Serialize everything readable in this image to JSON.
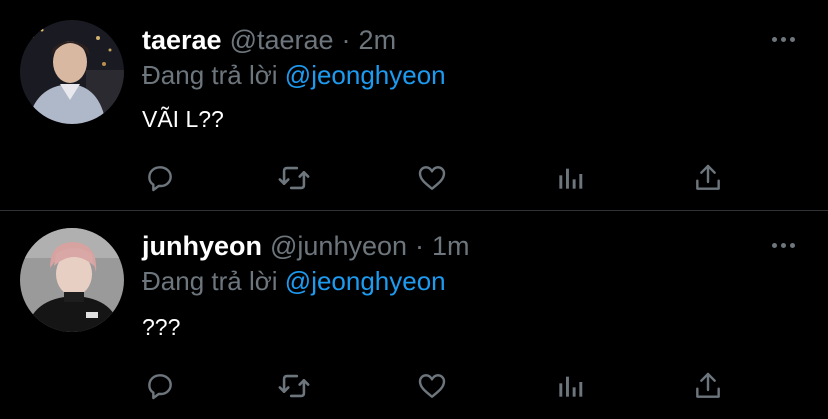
{
  "tweets": [
    {
      "name": "taerae",
      "handle": "@taerae",
      "separator": "·",
      "time": "2m",
      "reply_prefix": "Đang trả lời",
      "reply_to": "@jeonghyeon",
      "text": "VÃI L??"
    },
    {
      "name": "junhyeon",
      "handle": "@junhyeon",
      "separator": "·",
      "time": "1m",
      "reply_prefix": "Đang trả lời",
      "reply_to": "@jeonghyeon",
      "text": "???"
    }
  ],
  "icons": {
    "reply": "comment-bubble-icon",
    "retweet": "retweet-icon",
    "like": "heart-icon",
    "stats": "analytics-bars-icon",
    "share": "share-upload-icon",
    "more": "more-dots-icon"
  },
  "colors": {
    "background": "#000000",
    "text": "#ffffff",
    "muted": "#6e767d",
    "accent": "#1d9bf0",
    "divider": "#2f3336"
  }
}
